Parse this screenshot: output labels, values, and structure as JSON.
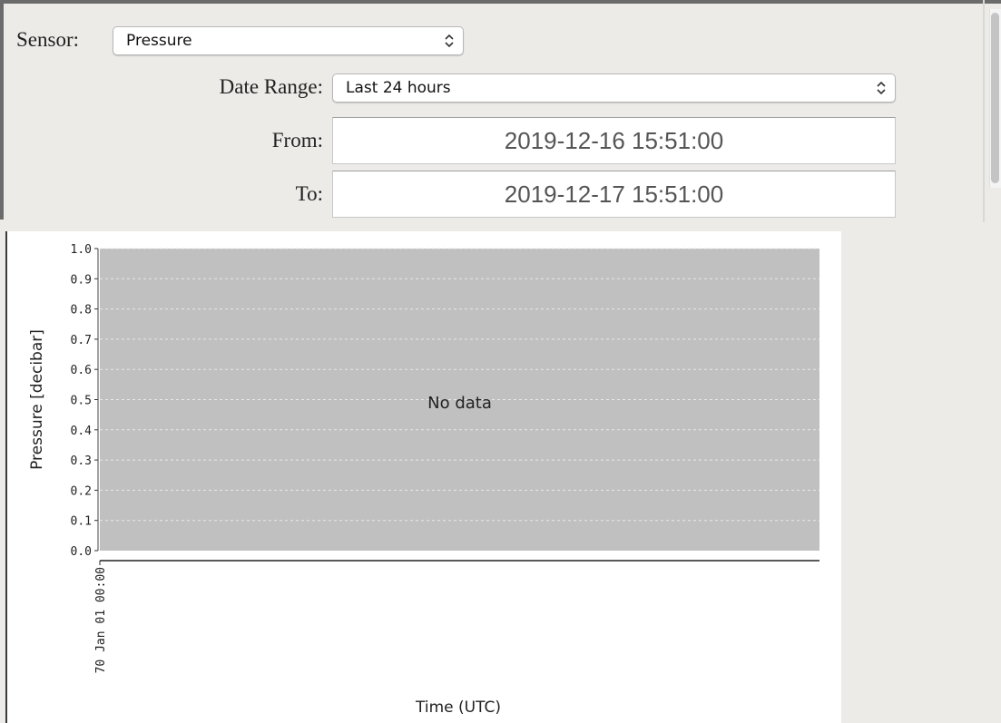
{
  "filters": {
    "sensor_label": "Sensor:",
    "sensor_value": "Pressure",
    "date_range_label": "Date Range:",
    "date_range_value": "Last 24 hours",
    "from_label": "From:",
    "from_value": "2019-12-16 15:51:00",
    "to_label": "To:",
    "to_value": "2019-12-17 15:51:00"
  },
  "chart_data": {
    "type": "line",
    "ylabel": "Pressure [decibar]",
    "xlabel": "Time (UTC)",
    "ylim": [
      0.0,
      1.0
    ],
    "y_ticks": [
      0.0,
      0.1,
      0.2,
      0.3,
      0.4,
      0.5,
      0.6,
      0.7,
      0.8,
      0.9,
      1.0
    ],
    "x_ticks": [
      "70 Jan 01 00:00"
    ],
    "grid": true,
    "series": [],
    "annotation": "No data",
    "plot_bg": "#c0c0c0",
    "grid_color": "#e8e8e8"
  }
}
